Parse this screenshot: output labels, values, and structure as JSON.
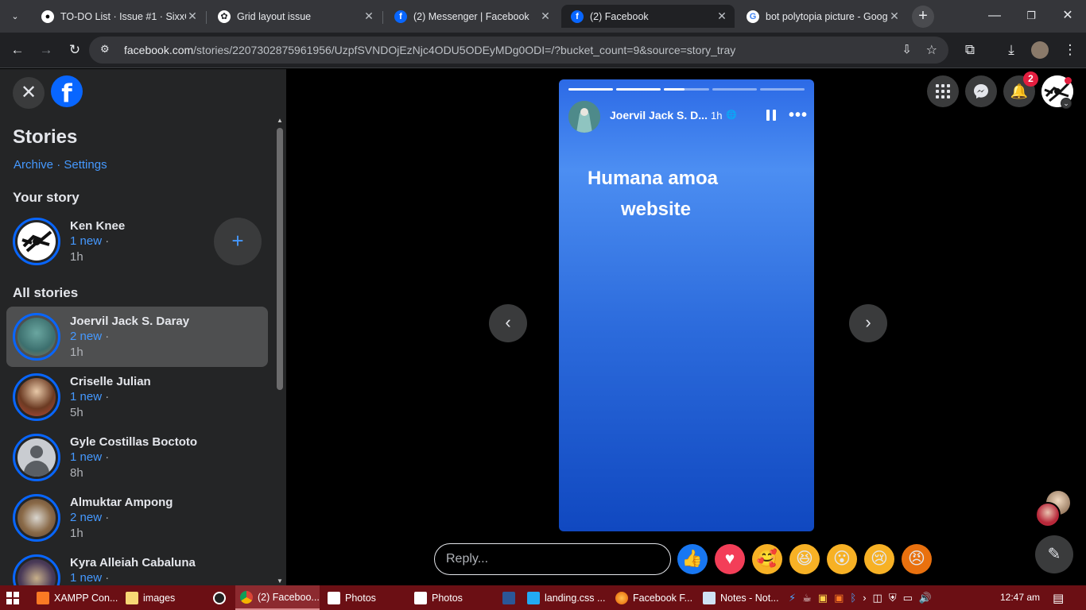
{
  "browser": {
    "tabs": [
      {
        "title": "TO-DO List · Issue #1 · SixxC",
        "icon": "github-icon"
      },
      {
        "title": "Grid layout issue",
        "icon": "openai-icon"
      },
      {
        "title": "(2) Messenger | Facebook",
        "icon": "facebook-icon"
      },
      {
        "title": "(2) Facebook",
        "icon": "facebook-icon",
        "active": true
      },
      {
        "title": "bot polytopia picture - Goog",
        "icon": "google-icon"
      }
    ],
    "url_domain": "facebook.com",
    "url_path": "/stories/2207302875961956/UzpfSVNDOjEzNjc4ODU5ODEyMDg0ODI=/?bucket_count=9&source=story_tray"
  },
  "sidebar": {
    "title": "Stories",
    "archive": "Archive",
    "separator": " · ",
    "settings": "Settings",
    "your_story_heading": "Your story",
    "your_story": {
      "name": "Ken Knee",
      "new": "1 new",
      "dot": " ·",
      "time": "1h"
    },
    "add_label": "+",
    "all_stories_heading": "All stories",
    "stories": [
      {
        "name": "Joervil Jack S. Daray",
        "new": "2 new",
        "dot": " ·",
        "time": "1h"
      },
      {
        "name": "Criselle Julian",
        "new": "1 new",
        "dot": " ·",
        "time": "5h"
      },
      {
        "name": "Gyle Costillas Boctoto",
        "new": "1 new",
        "dot": " ·",
        "time": "8h"
      },
      {
        "name": "Almuktar Ampong",
        "new": "2 new",
        "dot": " ·",
        "time": "1h"
      },
      {
        "name": "Kyra Alleiah Cabaluna",
        "new": "1 new",
        "dot": " ·",
        "time": ""
      }
    ]
  },
  "story_card": {
    "author": "Joervil Jack S. D...",
    "time": "1h",
    "text_line1": "Humana amoa",
    "text_line2": "website",
    "progress_segments": 5,
    "current_segment_progress": 0.45
  },
  "header": {
    "notification_count": "2"
  },
  "reply": {
    "placeholder": "Reply..."
  },
  "reactions": [
    "like",
    "love",
    "care",
    "haha",
    "wow",
    "sad",
    "angry"
  ],
  "taskbar": {
    "items": [
      "XAMPP Con...",
      "images",
      "(2) Faceboo...",
      "Photos",
      "Photos",
      "landing.css ...",
      "Facebook F...",
      "Notes - Not..."
    ],
    "clock": "12:47 am"
  }
}
